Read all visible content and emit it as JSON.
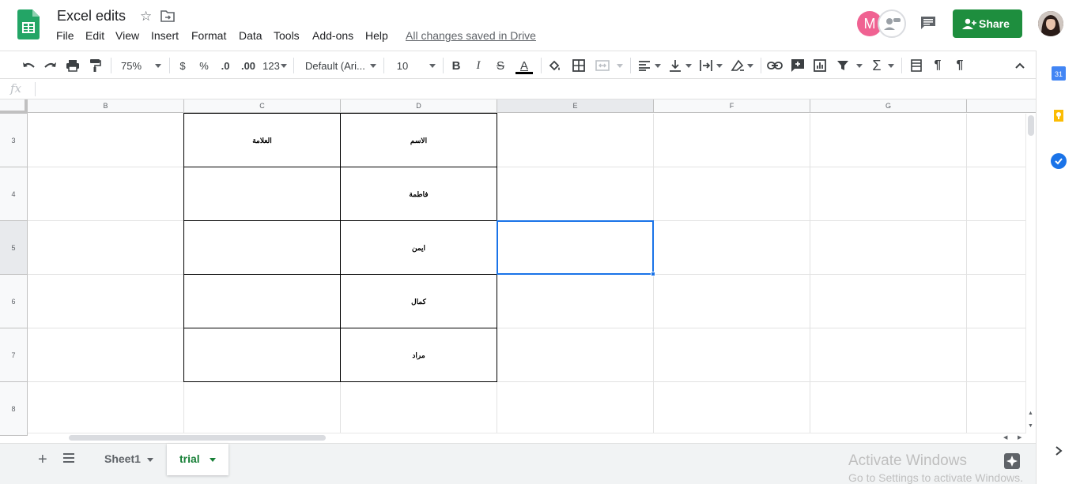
{
  "header": {
    "title": "Excel edits",
    "menus": [
      "File",
      "Edit",
      "View",
      "Insert",
      "Format",
      "Data",
      "Tools",
      "Add-ons",
      "Help"
    ],
    "save_status": "All changes saved in Drive",
    "avatar_letter": "M",
    "share_label": "Share"
  },
  "toolbar": {
    "zoom": "75%",
    "currency": "$",
    "percent": "%",
    "decimal_decrease": ".0",
    "decimal_increase": ".00",
    "more_formats": "123",
    "font": "Default (Ari...",
    "font_size": "10",
    "bold": "B",
    "italic": "I",
    "strike": "S",
    "text_color": "A",
    "functions": "Σ"
  },
  "formula_bar": {
    "fx": "fx",
    "value": ""
  },
  "grid": {
    "columns": [
      "B",
      "C",
      "D",
      "E",
      "F",
      "G"
    ],
    "selected_column": "E",
    "rows": [
      {
        "num": "3",
        "C": "العلامة",
        "D": "الاسم"
      },
      {
        "num": "4",
        "C": "",
        "D": "فاطمة"
      },
      {
        "num": "5",
        "C": "",
        "D": "ايمن"
      },
      {
        "num": "6",
        "C": "",
        "D": "كمال"
      },
      {
        "num": "7",
        "C": "",
        "D": "مراد"
      },
      {
        "num": "8",
        "C": "",
        "D": ""
      }
    ],
    "selected_cell": "E5"
  },
  "sheets": {
    "tabs": [
      "Sheet1",
      "trial"
    ],
    "active": "trial"
  },
  "side_panel": {
    "icons": [
      "calendar-icon",
      "keep-icon",
      "tasks-icon"
    ],
    "calendar_day": "31"
  },
  "watermark": {
    "title": "Activate Windows",
    "subtitle": "Go to Settings to activate Windows."
  },
  "colors": {
    "accent": "#1a73e8",
    "share": "#1e8e3e",
    "active_tab": "#188038"
  }
}
